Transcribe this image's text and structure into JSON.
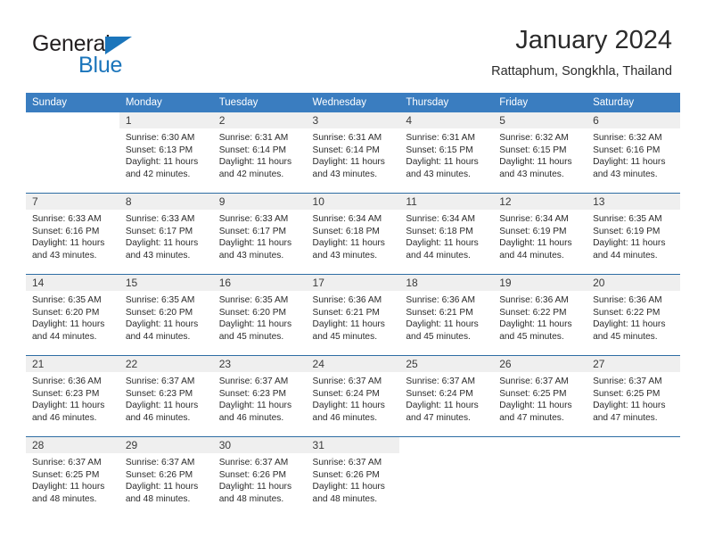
{
  "brand": {
    "line1": "General",
    "line2": "Blue",
    "flag_icon": "triangle-flag-icon",
    "accent_color": "#1b75bb"
  },
  "header": {
    "title": "January 2024",
    "subtitle": "Rattaphum, Songkhla, Thailand"
  },
  "colors": {
    "header_row_bg": "#3a7dc0",
    "header_row_text": "#ffffff",
    "daynum_band_bg": "#efefef",
    "week_divider": "#2e6da4",
    "body_text": "#2b2b2b"
  },
  "calendar": {
    "weekday_headers": [
      "Sunday",
      "Monday",
      "Tuesday",
      "Wednesday",
      "Thursday",
      "Friday",
      "Saturday"
    ],
    "weeks": [
      [
        {
          "day": "",
          "lines": [],
          "blank": true
        },
        {
          "day": "1",
          "lines": [
            "Sunrise: 6:30 AM",
            "Sunset: 6:13 PM",
            "Daylight: 11 hours",
            "and 42 minutes."
          ]
        },
        {
          "day": "2",
          "lines": [
            "Sunrise: 6:31 AM",
            "Sunset: 6:14 PM",
            "Daylight: 11 hours",
            "and 42 minutes."
          ]
        },
        {
          "day": "3",
          "lines": [
            "Sunrise: 6:31 AM",
            "Sunset: 6:14 PM",
            "Daylight: 11 hours",
            "and 43 minutes."
          ]
        },
        {
          "day": "4",
          "lines": [
            "Sunrise: 6:31 AM",
            "Sunset: 6:15 PM",
            "Daylight: 11 hours",
            "and 43 minutes."
          ]
        },
        {
          "day": "5",
          "lines": [
            "Sunrise: 6:32 AM",
            "Sunset: 6:15 PM",
            "Daylight: 11 hours",
            "and 43 minutes."
          ]
        },
        {
          "day": "6",
          "lines": [
            "Sunrise: 6:32 AM",
            "Sunset: 6:16 PM",
            "Daylight: 11 hours",
            "and 43 minutes."
          ]
        }
      ],
      [
        {
          "day": "7",
          "lines": [
            "Sunrise: 6:33 AM",
            "Sunset: 6:16 PM",
            "Daylight: 11 hours",
            "and 43 minutes."
          ]
        },
        {
          "day": "8",
          "lines": [
            "Sunrise: 6:33 AM",
            "Sunset: 6:17 PM",
            "Daylight: 11 hours",
            "and 43 minutes."
          ]
        },
        {
          "day": "9",
          "lines": [
            "Sunrise: 6:33 AM",
            "Sunset: 6:17 PM",
            "Daylight: 11 hours",
            "and 43 minutes."
          ]
        },
        {
          "day": "10",
          "lines": [
            "Sunrise: 6:34 AM",
            "Sunset: 6:18 PM",
            "Daylight: 11 hours",
            "and 43 minutes."
          ]
        },
        {
          "day": "11",
          "lines": [
            "Sunrise: 6:34 AM",
            "Sunset: 6:18 PM",
            "Daylight: 11 hours",
            "and 44 minutes."
          ]
        },
        {
          "day": "12",
          "lines": [
            "Sunrise: 6:34 AM",
            "Sunset: 6:19 PM",
            "Daylight: 11 hours",
            "and 44 minutes."
          ]
        },
        {
          "day": "13",
          "lines": [
            "Sunrise: 6:35 AM",
            "Sunset: 6:19 PM",
            "Daylight: 11 hours",
            "and 44 minutes."
          ]
        }
      ],
      [
        {
          "day": "14",
          "lines": [
            "Sunrise: 6:35 AM",
            "Sunset: 6:20 PM",
            "Daylight: 11 hours",
            "and 44 minutes."
          ]
        },
        {
          "day": "15",
          "lines": [
            "Sunrise: 6:35 AM",
            "Sunset: 6:20 PM",
            "Daylight: 11 hours",
            "and 44 minutes."
          ]
        },
        {
          "day": "16",
          "lines": [
            "Sunrise: 6:35 AM",
            "Sunset: 6:20 PM",
            "Daylight: 11 hours",
            "and 45 minutes."
          ]
        },
        {
          "day": "17",
          "lines": [
            "Sunrise: 6:36 AM",
            "Sunset: 6:21 PM",
            "Daylight: 11 hours",
            "and 45 minutes."
          ]
        },
        {
          "day": "18",
          "lines": [
            "Sunrise: 6:36 AM",
            "Sunset: 6:21 PM",
            "Daylight: 11 hours",
            "and 45 minutes."
          ]
        },
        {
          "day": "19",
          "lines": [
            "Sunrise: 6:36 AM",
            "Sunset: 6:22 PM",
            "Daylight: 11 hours",
            "and 45 minutes."
          ]
        },
        {
          "day": "20",
          "lines": [
            "Sunrise: 6:36 AM",
            "Sunset: 6:22 PM",
            "Daylight: 11 hours",
            "and 45 minutes."
          ]
        }
      ],
      [
        {
          "day": "21",
          "lines": [
            "Sunrise: 6:36 AM",
            "Sunset: 6:23 PM",
            "Daylight: 11 hours",
            "and 46 minutes."
          ]
        },
        {
          "day": "22",
          "lines": [
            "Sunrise: 6:37 AM",
            "Sunset: 6:23 PM",
            "Daylight: 11 hours",
            "and 46 minutes."
          ]
        },
        {
          "day": "23",
          "lines": [
            "Sunrise: 6:37 AM",
            "Sunset: 6:23 PM",
            "Daylight: 11 hours",
            "and 46 minutes."
          ]
        },
        {
          "day": "24",
          "lines": [
            "Sunrise: 6:37 AM",
            "Sunset: 6:24 PM",
            "Daylight: 11 hours",
            "and 46 minutes."
          ]
        },
        {
          "day": "25",
          "lines": [
            "Sunrise: 6:37 AM",
            "Sunset: 6:24 PM",
            "Daylight: 11 hours",
            "and 47 minutes."
          ]
        },
        {
          "day": "26",
          "lines": [
            "Sunrise: 6:37 AM",
            "Sunset: 6:25 PM",
            "Daylight: 11 hours",
            "and 47 minutes."
          ]
        },
        {
          "day": "27",
          "lines": [
            "Sunrise: 6:37 AM",
            "Sunset: 6:25 PM",
            "Daylight: 11 hours",
            "and 47 minutes."
          ]
        }
      ],
      [
        {
          "day": "28",
          "lines": [
            "Sunrise: 6:37 AM",
            "Sunset: 6:25 PM",
            "Daylight: 11 hours",
            "and 48 minutes."
          ]
        },
        {
          "day": "29",
          "lines": [
            "Sunrise: 6:37 AM",
            "Sunset: 6:26 PM",
            "Daylight: 11 hours",
            "and 48 minutes."
          ]
        },
        {
          "day": "30",
          "lines": [
            "Sunrise: 6:37 AM",
            "Sunset: 6:26 PM",
            "Daylight: 11 hours",
            "and 48 minutes."
          ]
        },
        {
          "day": "31",
          "lines": [
            "Sunrise: 6:37 AM",
            "Sunset: 6:26 PM",
            "Daylight: 11 hours",
            "and 48 minutes."
          ]
        },
        {
          "day": "",
          "lines": [],
          "blank": true
        },
        {
          "day": "",
          "lines": [],
          "blank": true
        },
        {
          "day": "",
          "lines": [],
          "blank": true
        }
      ]
    ]
  }
}
